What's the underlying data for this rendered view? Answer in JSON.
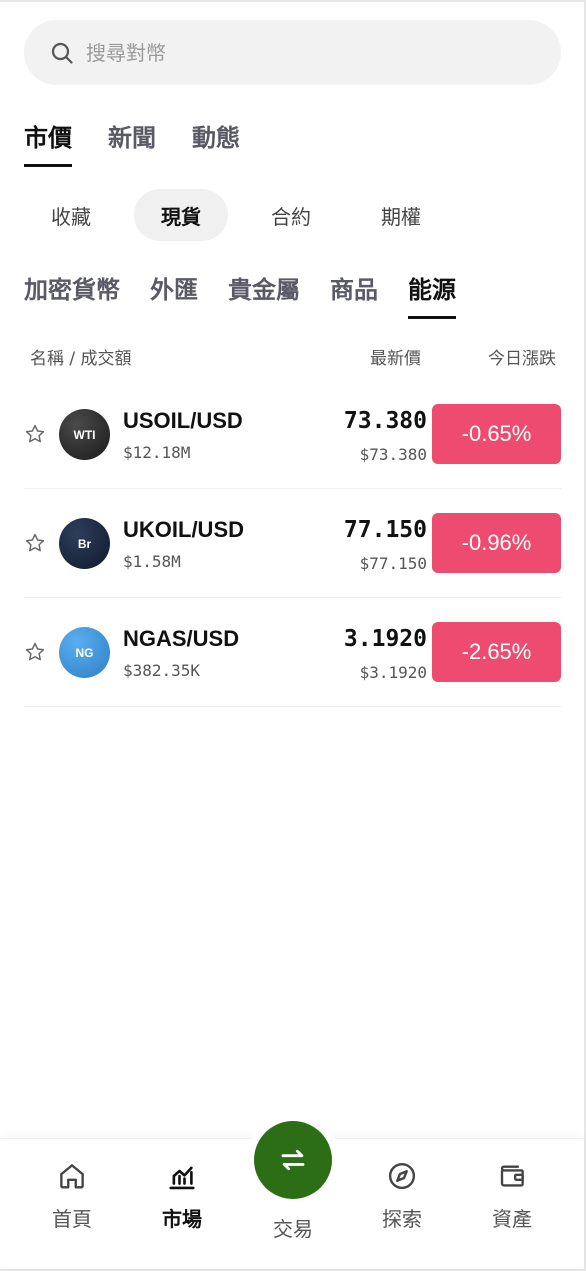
{
  "search": {
    "placeholder": "搜尋對幣"
  },
  "main_tabs": [
    "市價",
    "新聞",
    "動態"
  ],
  "segments": [
    "收藏",
    "現貨",
    "合約",
    "期權"
  ],
  "categories": [
    "加密貨幣",
    "外匯",
    "貴金屬",
    "商品",
    "能源"
  ],
  "columns": {
    "name_volume": "名稱 / 成交額",
    "last_price": "最新價",
    "change": "今日漲跌"
  },
  "rows": [
    {
      "logo": "WTI",
      "symbol": "USOIL/USD",
      "volume": "$12.18M",
      "price": "73.380",
      "price_usd": "$73.380",
      "change": "-0.65%",
      "logo_color": "#2a2a2a"
    },
    {
      "logo": "Br",
      "symbol": "UKOIL/USD",
      "volume": "$1.58M",
      "price": "77.150",
      "price_usd": "$77.150",
      "change": "-0.96%",
      "logo_color": "#1c2a44"
    },
    {
      "logo": "NG",
      "symbol": "NGAS/USD",
      "volume": "$382.35K",
      "price": "3.1920",
      "price_usd": "$3.1920",
      "change": "-2.65%",
      "logo_color": "#3f93d8"
    }
  ],
  "colors": {
    "down": "#ee4b70",
    "fab": "#2b6e16"
  },
  "bottom_nav": [
    "首頁",
    "市場",
    "交易",
    "探索",
    "資產"
  ]
}
